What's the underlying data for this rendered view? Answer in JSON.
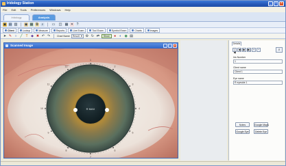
{
  "window": {
    "title": "Iridology Station",
    "title_icon": "eye-app-icon",
    "controls": [
      "_",
      "□",
      "×"
    ]
  },
  "menu": [
    "File",
    "Edit",
    "Tools",
    "Preferences",
    "Windows",
    "Help"
  ],
  "ribbon_tabs": [
    {
      "label": "Iridology",
      "active": false
    },
    {
      "label": "Analysis",
      "active": true
    }
  ],
  "panel_tabs": [
    "Client",
    "Lookup",
    "Measure",
    "Reports",
    "Live Exam",
    "Tool Exam",
    "Symbol Exam",
    "Charts",
    "Images"
  ],
  "toolbar3": {
    "chart_label": "Chart Name",
    "chart_value": "Result",
    "view_button": "Show"
  },
  "image_window": {
    "title": "Scanned Image",
    "pupil_label": "R MAX",
    "ring_ticks": [
      1,
      2,
      3,
      4,
      5,
      6,
      7,
      8,
      9,
      10,
      11,
      12
    ]
  },
  "right_panel": {
    "tab": "Details",
    "nav_buttons": [
      "|◀",
      "◀",
      "▶",
      "▶|",
      "+",
      "−"
    ],
    "fields": [
      {
        "label": "Iris Number",
        "value": "1"
      },
      {
        "label": "Client name",
        "value": "Client 1"
      },
      {
        "label": "Eye name",
        "value": "R eyeside 1"
      }
    ],
    "buttons": [
      "Notes",
      "Google Maps",
      "Google Eye",
      "Delete Eye"
    ]
  },
  "colors": {
    "accent": "#2f64c4",
    "iris_outer": "#5a6f5e",
    "iris_inner": "#b08a3a",
    "pupil": "#0e1b1f",
    "skin": "#d79884",
    "sclera": "#f0ebe4"
  }
}
